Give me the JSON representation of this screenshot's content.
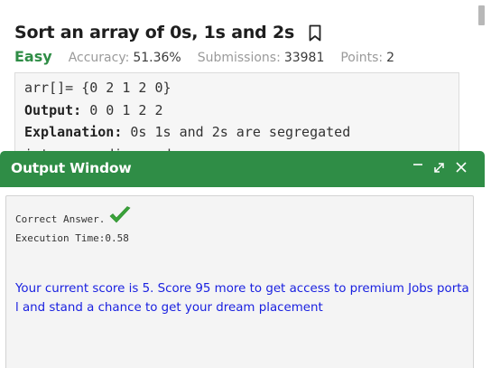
{
  "problem": {
    "title": "Sort an array of 0s, 1s and 2s",
    "difficulty": "Easy",
    "accuracy_label": "Accuracy:",
    "accuracy_value": "51.36%",
    "submissions_label": "Submissions:",
    "submissions_value": "33981",
    "points_label": "Points:",
    "points_value": "2"
  },
  "example": {
    "input_line": "arr[]= {0 2 1 2 0}",
    "output_label": "Output:",
    "output_value": " 0 0 1 2 2",
    "explanation_label": "Explanation:",
    "explanation_value": " 0s 1s and 2s are segregated",
    "cut_line": "into ascending order."
  },
  "output_window": {
    "title": "Output Window",
    "result_text": "Correct Answer.",
    "exec_time": "Execution Time:0.58",
    "score_message": "Your current score is 5. Score 95 more to get access to premium Jobs portal and stand a chance to get your dream placement"
  },
  "colors": {
    "brand_green": "#2f8d46",
    "message_blue": "#1a21e0",
    "check_green": "#3aa33a"
  },
  "icons": {
    "bookmark": "bookmark-icon",
    "minimize": "minimize-icon",
    "expand": "expand-icon",
    "close": "close-icon",
    "check": "check-icon"
  }
}
